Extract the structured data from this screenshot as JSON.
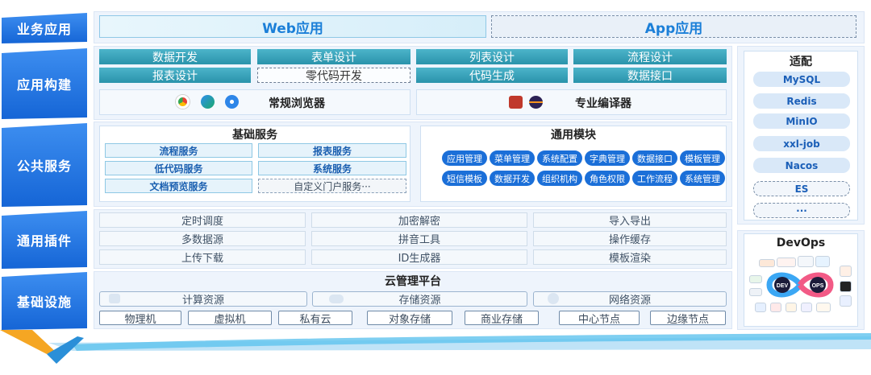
{
  "rows": {
    "business": "业务应用",
    "build": "应用构建",
    "public": "公共服务",
    "plugins": "通用插件",
    "infra": "基础设施"
  },
  "business": {
    "web": "Web应用",
    "app": "App应用"
  },
  "build": {
    "row1": [
      "数据开发",
      "表单设计",
      "列表设计",
      "流程设计"
    ],
    "row2": [
      "报表设计",
      "零代码开发",
      "代码生成",
      "数据接口"
    ],
    "browser_label": "常规浏览器",
    "compiler_label": "专业编译器"
  },
  "adapt": {
    "title": "适配",
    "items": [
      "MySQL",
      "Redis",
      "MinIO",
      "xxl-job",
      "Nacos"
    ],
    "dashed": [
      "ES",
      "···"
    ]
  },
  "public": {
    "base_title": "基础服务",
    "base_items": [
      "流程服务",
      "报表服务",
      "低代码服务",
      "系统服务",
      "文档预览服务",
      "自定义门户服务···"
    ],
    "common_title": "通用模块",
    "common_items": [
      "应用管理",
      "菜单管理",
      "系统配置",
      "字典管理",
      "数据接口",
      "模板管理",
      "短信模板",
      "数据开发",
      "组织机构",
      "角色权限",
      "工作流程",
      "系统管理"
    ]
  },
  "plugins": {
    "items": [
      "定时调度",
      "加密解密",
      "导入导出",
      "多数据源",
      "拼音工具",
      "操作缓存",
      "上传下载",
      "ID生成器",
      "模板渲染"
    ]
  },
  "devops": {
    "title": "DevOps",
    "dev": "DEV",
    "ops": "OPS"
  },
  "infra": {
    "title": "云管理平台",
    "resources": [
      "计算资源",
      "存储资源",
      "网络资源"
    ],
    "nodes": [
      "物理机",
      "虚拟机",
      "私有云",
      "对象存储",
      "商业存储",
      "中心节点",
      "边缘节点"
    ]
  },
  "colors": {
    "primary": "#1b6fd8",
    "teal": "#2a93ab",
    "accent_orange": "#f5a623"
  }
}
